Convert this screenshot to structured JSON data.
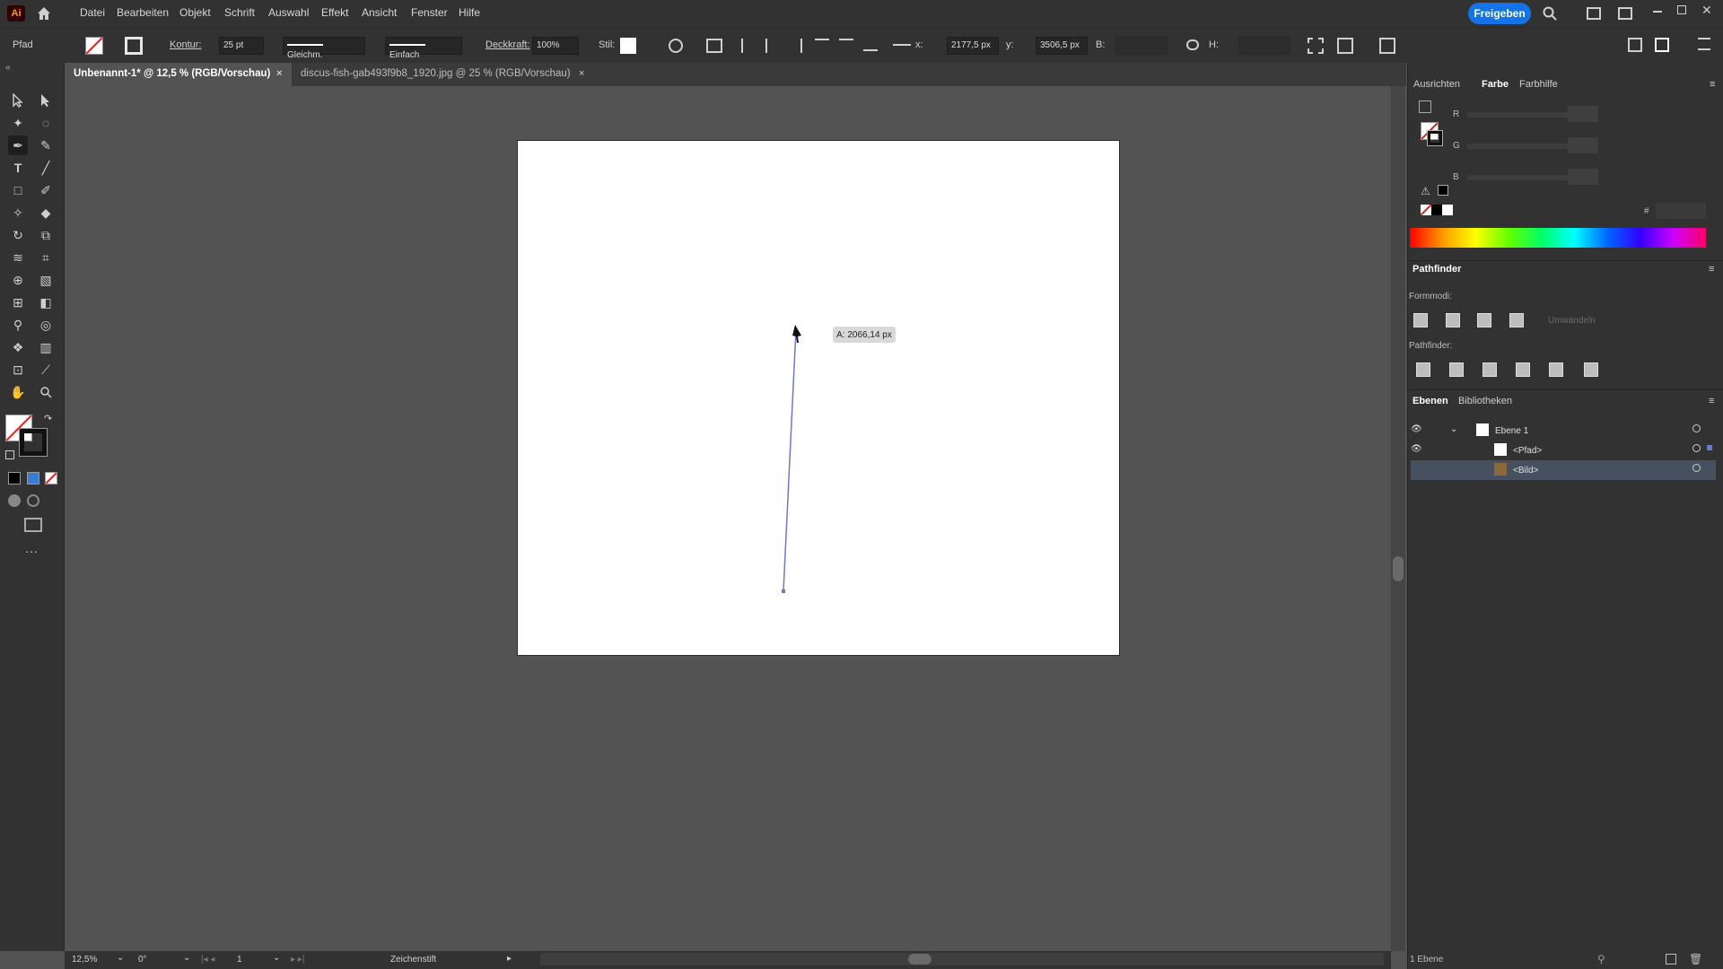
{
  "menubar": {
    "logo": "Ai",
    "items": [
      "Datei",
      "Bearbeiten",
      "Objekt",
      "Schrift",
      "Auswahl",
      "Effekt",
      "Ansicht",
      "Fenster",
      "Hilfe"
    ],
    "share_label": "Freigeben"
  },
  "control": {
    "object_type": "Pfad",
    "stroke_label": "Kontur:",
    "stroke_value": "25 pt",
    "stroke_profile": "Gleichm.",
    "brush": "Einfach",
    "opacity_label": "Deckkraft:",
    "opacity_value": "100%",
    "style_label": "Stil:",
    "x_label": "x:",
    "x_value": "2177,5 px",
    "y_label": "y:",
    "y_value": "3506,5 px",
    "w_label": "B:",
    "h_label": "H:"
  },
  "tabs": [
    {
      "label": "Unbenannt-1* @ 12,5 % (RGB/Vorschau)",
      "close": "×"
    },
    {
      "label": "discus-fish-gab493f9b8_1920.jpg @ 25 % (RGB/Vorschau)",
      "close": "×"
    }
  ],
  "canvas": {
    "tooltip": "A: 2066,14 px"
  },
  "panels": {
    "color_tabs": [
      "Ausrichten",
      "Farbe",
      "Farbhilfe"
    ],
    "channels": [
      "R",
      "G",
      "B"
    ],
    "hex_symbol": "#",
    "pathfinder_title": "Pathfinder",
    "shape_modes_label": "Formmodi:",
    "expand_label": "Umwandeln",
    "pathfinders_label": "Pathfinder:",
    "layers_tabs": [
      "Ebenen",
      "Bibliotheken"
    ],
    "layers": [
      {
        "name": "Ebene 1"
      },
      {
        "name": "<Pfad>"
      },
      {
        "name": "<Bild>"
      }
    ],
    "layers_count": "1 Ebene"
  },
  "status": {
    "zoom": "12,5%",
    "rotation": "0°",
    "artboard_num": "1",
    "tool_name": "Zeichenstift"
  },
  "colors": {
    "accent": "#1473e6",
    "path_stroke": "#6f79c9",
    "selected_layer": "#46505f"
  }
}
